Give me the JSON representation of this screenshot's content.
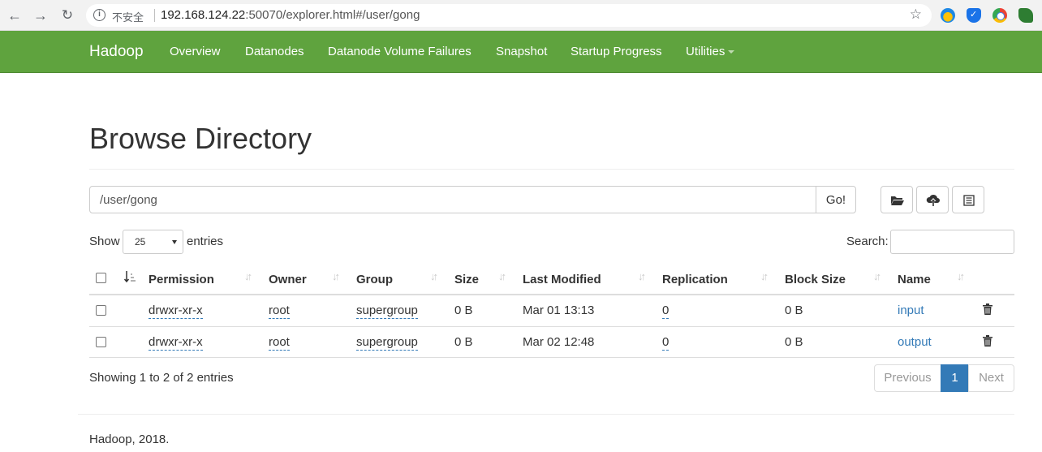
{
  "browser": {
    "insecure_label": "不安全",
    "url_host": "192.168.124.22",
    "url_rest": ":50070/explorer.html#/user/gong"
  },
  "navbar": {
    "brand": "Hadoop",
    "links": [
      "Overview",
      "Datanodes",
      "Datanode Volume Failures",
      "Snapshot",
      "Startup Progress",
      "Utilities"
    ],
    "color": "#5fa33e"
  },
  "page": {
    "title": "Browse Directory",
    "path_value": "/user/gong",
    "go_label": "Go!"
  },
  "table_controls": {
    "show_label": "Show",
    "entries_value": "25",
    "entries_label": "entries",
    "search_label": "Search:"
  },
  "table": {
    "columns": [
      "Permission",
      "Owner",
      "Group",
      "Size",
      "Last Modified",
      "Replication",
      "Block Size",
      "Name"
    ],
    "rows": [
      {
        "permission": "drwxr-xr-x",
        "owner": "root",
        "group": "supergroup",
        "size": "0 B",
        "last_modified": "Mar 01 13:13",
        "replication": "0",
        "block_size": "0 B",
        "name": "input"
      },
      {
        "permission": "drwxr-xr-x",
        "owner": "root",
        "group": "supergroup",
        "size": "0 B",
        "last_modified": "Mar 02 12:48",
        "replication": "0",
        "block_size": "0 B",
        "name": "output"
      }
    ]
  },
  "pagination": {
    "info": "Showing 1 to 2 of 2 entries",
    "previous": "Previous",
    "current": "1",
    "next": "Next"
  },
  "footer": {
    "text": "Hadoop, 2018."
  }
}
